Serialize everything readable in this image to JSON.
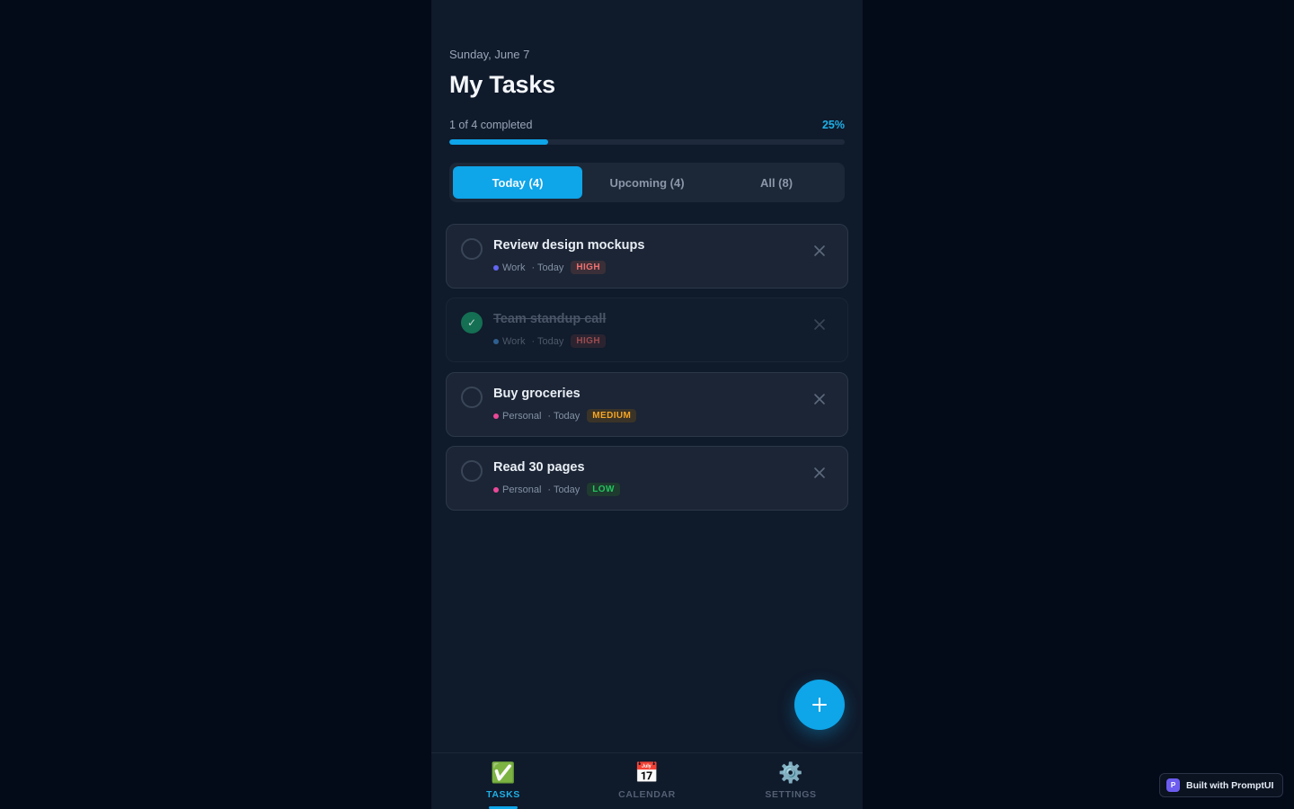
{
  "header": {
    "date": "Sunday, June 7",
    "title": "My Tasks"
  },
  "progress": {
    "label": "1 of 4 completed",
    "percent_label": "25%",
    "fraction": 0.25
  },
  "tabs": [
    {
      "label": "Today (4)",
      "active": true
    },
    {
      "label": "Upcoming (4)",
      "active": false
    },
    {
      "label": "All (8)",
      "active": false
    }
  ],
  "tasks": [
    {
      "title": "Review design mockups",
      "category": "Work",
      "category_color": "#6366f1",
      "due": "· Today",
      "priority": "HIGH",
      "done": false
    },
    {
      "title": "Team standup call",
      "category": "Work",
      "category_color": "#3b82f6",
      "due": "· Today",
      "priority": "HIGH",
      "done": true,
      "check_glyph": "✓"
    },
    {
      "title": "Buy groceries",
      "category": "Personal",
      "category_color": "#ec4899",
      "due": "· Today",
      "priority": "MEDIUM",
      "done": false
    },
    {
      "title": "Read 30 pages",
      "category": "Personal",
      "category_color": "#ec4899",
      "due": "· Today",
      "priority": "LOW",
      "done": false
    }
  ],
  "fab": {
    "icon": "plus-icon"
  },
  "nav": [
    {
      "icon": "check-box-icon",
      "glyph": "✅",
      "label": "TASKS",
      "active": true
    },
    {
      "icon": "calendar-icon",
      "glyph": "📅",
      "label": "CALENDAR",
      "active": false
    },
    {
      "icon": "gear-icon",
      "glyph": "⚙️",
      "label": "SETTINGS",
      "active": false
    }
  ],
  "built_with": {
    "logo": "P",
    "label": "Built with PromptUI"
  },
  "colors": {
    "accent": "#0ea5e9",
    "background": "#030a18",
    "panel": "#0f1a2b",
    "done_green": "#15845d"
  }
}
